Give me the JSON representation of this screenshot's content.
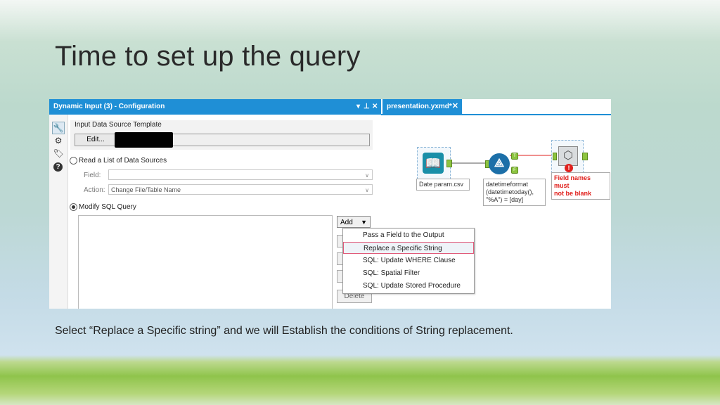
{
  "slide": {
    "title": "Time to set up the query",
    "caption": "Select “Replace a Specific string” and we will Establish the conditions of String replacement."
  },
  "config_panel": {
    "header_title": "Dynamic Input (3) - Configuration",
    "header_controls": [
      "▾",
      "⊥",
      "✕"
    ],
    "toolbar_icons": [
      "wrench-icon",
      "gear-icon",
      "tag-icon",
      "help-icon"
    ],
    "template_section_label": "Input Data Source Template",
    "edit_button_label": "Edit...",
    "read_list_label": "Read a List of Data Sources",
    "field_label": "Field:",
    "field_value": "",
    "action_label": "Action:",
    "action_value": "Change File/Table Name",
    "modify_sql_label": "Modify SQL Query",
    "add_button_label": "Add",
    "delete_button_label": "Delete",
    "selected_radio": "Modify SQL Query"
  },
  "add_menu": {
    "items": [
      "Pass a Field to the Output",
      "Replace a Specific String",
      "SQL: Update WHERE Clause",
      "SQL: Spatial Filter",
      "SQL: Update Stored Procedure"
    ],
    "highlighted_item": "Replace a Specific String"
  },
  "workflow": {
    "tab_label": "presentation.yxmd*",
    "tab_close": "✕",
    "input_node_label": "Date param.csv",
    "formula_node_label_lines": [
      "datetimeformat",
      "(datetimetoday(),",
      "\"%A\") = [day]"
    ],
    "dynamic_node_error_lines": [
      "Field names must",
      "not be blank"
    ],
    "anchor_labels": [
      "T",
      "F"
    ]
  }
}
